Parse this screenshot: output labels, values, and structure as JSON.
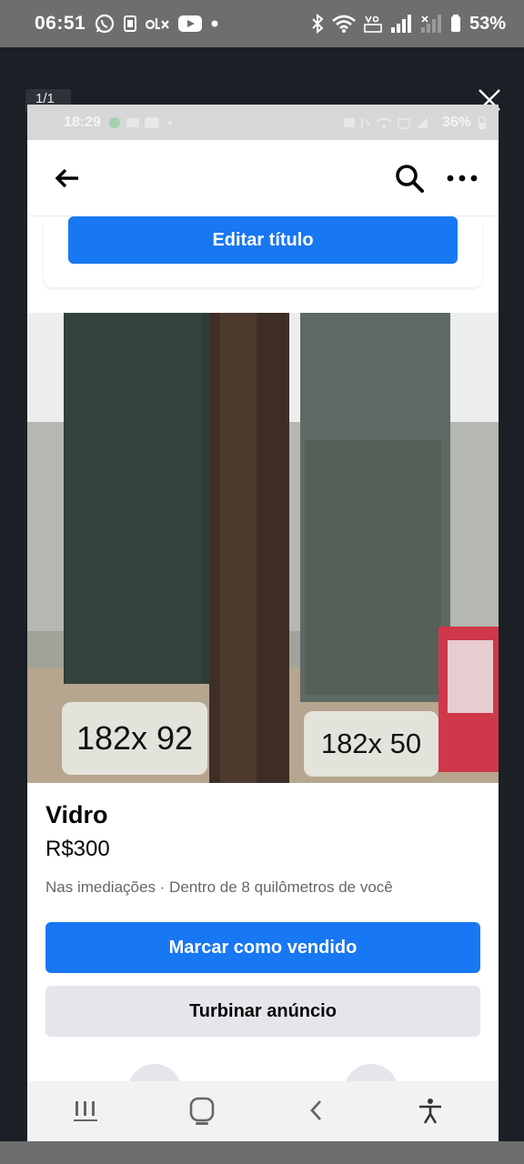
{
  "outer_status": {
    "time": "06:51",
    "battery": "53%"
  },
  "viewer": {
    "counter": "1/1"
  },
  "inner_status": {
    "time": "18:29",
    "battery": "36%"
  },
  "listing": {
    "edit_title_label": "Editar título",
    "photo_labels": [
      "182x 92",
      "182x 50"
    ],
    "title": "Vidro",
    "price": "R$300",
    "location": "Nas imediações · Dentro de 8 quilômetros de você",
    "mark_sold_label": "Marcar como vendido",
    "boost_label": "Turbinar anúncio"
  },
  "icons": {
    "back": "arrow-left-icon",
    "search": "search-icon",
    "more": "more-icon",
    "close": "close-icon"
  },
  "colors": {
    "primary": "#1877f2",
    "secondary_button": "#e4e6eb"
  }
}
